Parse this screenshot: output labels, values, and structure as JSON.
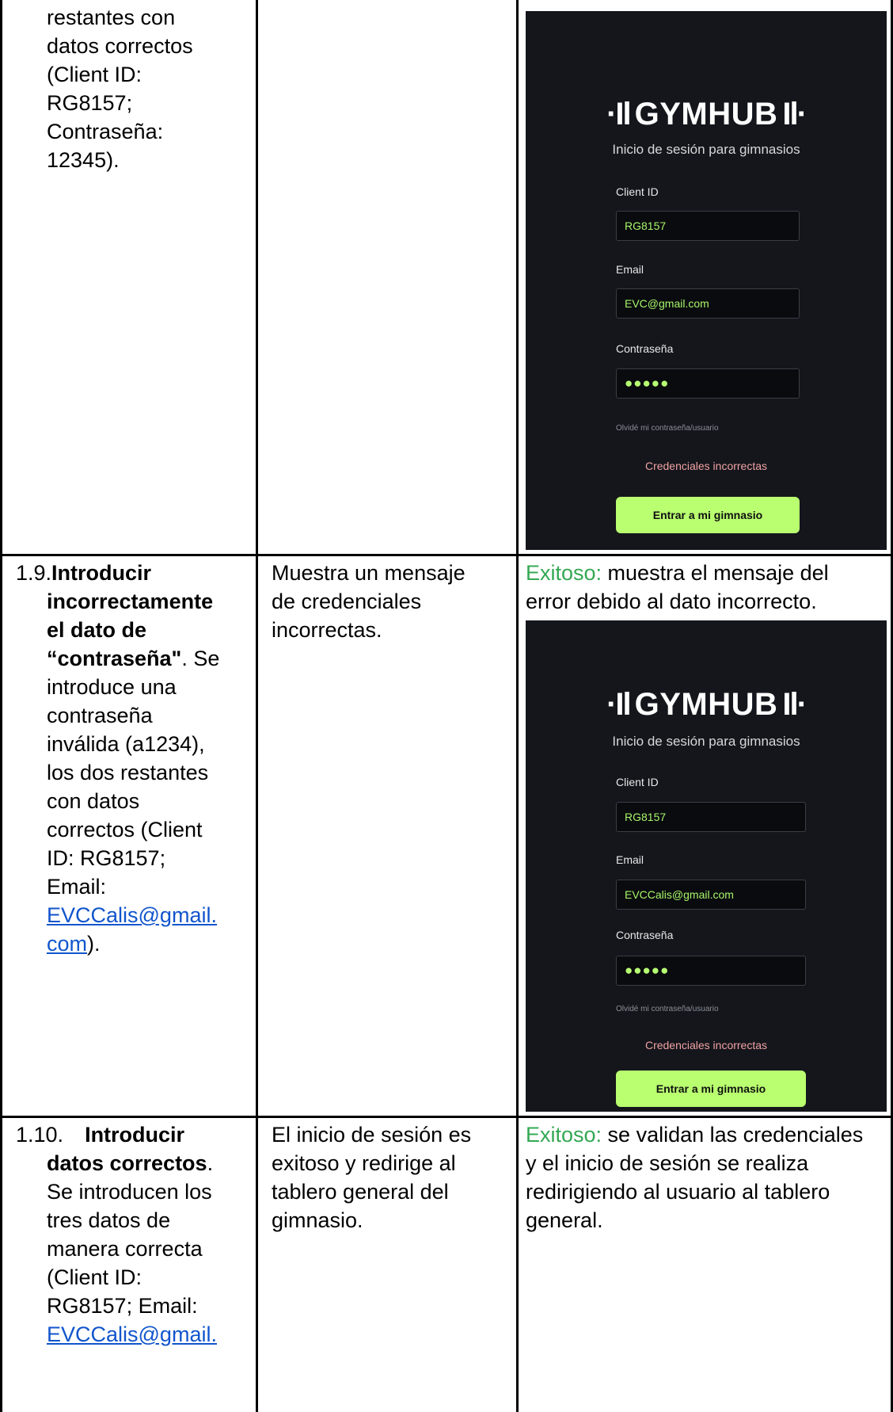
{
  "rows": [
    {
      "step": {
        "lines": [
          "restantes con",
          "datos correctos",
          "(Client ID:",
          "RG8157;",
          "Contraseña:",
          "12345)."
        ]
      },
      "expected": "",
      "screenshot": {
        "logo": "GYMHUB",
        "logo_bars_left": "·Il",
        "logo_bars_right": "Il·",
        "subtitle": "Inicio de sesión para gimnasios",
        "fields": [
          {
            "label": "Client ID",
            "value": "RG8157"
          },
          {
            "label": "Email",
            "value": "EVC@gmail.com"
          },
          {
            "label": "Contraseña",
            "value": "●●●●●"
          }
        ],
        "forgot": "Olvidé mi contraseña/usuario",
        "error": "Credenciales incorrectas",
        "button": "Entrar a mi gimnasio"
      }
    },
    {
      "step": {
        "number": "1.9.",
        "bold1": "Introducir",
        "bold_lines": [
          "incorrectamente",
          "el dato de",
          "“contraseña\""
        ],
        "after_bold": ". Se",
        "lines": [
          "introduce una",
          "contraseña",
          "inválida (a1234),",
          "los dos restantes",
          "con datos",
          "correctos (Client",
          "ID: RG8157;",
          "Email:"
        ],
        "link1": "EVCCalis@gmail.",
        "link2": "com",
        "end": ")."
      },
      "expected": {
        "lines": [
          "Muestra un mensaje",
          "de credenciales",
          "incorrectas."
        ]
      },
      "result": {
        "status": "Exitoso:",
        "text1": " muestra el mensaje del",
        "text2": "error debido al dato incorrecto."
      },
      "screenshot": {
        "logo": "GYMHUB",
        "logo_bars_left": "·Il",
        "logo_bars_right": "Il·",
        "subtitle": "Inicio de sesión para gimnasios",
        "fields": [
          {
            "label": "Client ID",
            "value": "RG8157"
          },
          {
            "label": "Email",
            "value": "EVCCalis@gmail.com"
          },
          {
            "label": "Contraseña",
            "value": "●●●●●"
          }
        ],
        "forgot": "Olvidé mi contraseña/usuario",
        "error": "Credenciales incorrectas",
        "button": "Entrar a mi gimnasio"
      }
    },
    {
      "step": {
        "number": "1.10.",
        "bold1": "Introducir",
        "bold2": "datos correctos",
        "after_bold": ".",
        "lines": [
          "Se introducen los",
          "tres datos de",
          "manera correcta",
          "(Client ID:",
          "RG8157; Email:"
        ],
        "link1": "EVCCalis@gmail."
      },
      "expected": {
        "lines": [
          "El inicio de sesión es",
          "exitoso y redirige al",
          "tablero general del",
          "gimnasio."
        ]
      },
      "result": {
        "status": "Exitoso:",
        "text1": " se validan las credenciales",
        "lines": [
          "y el inicio de sesión se realiza",
          "redirigiendo al usuario al tablero",
          "general."
        ]
      }
    }
  ]
}
